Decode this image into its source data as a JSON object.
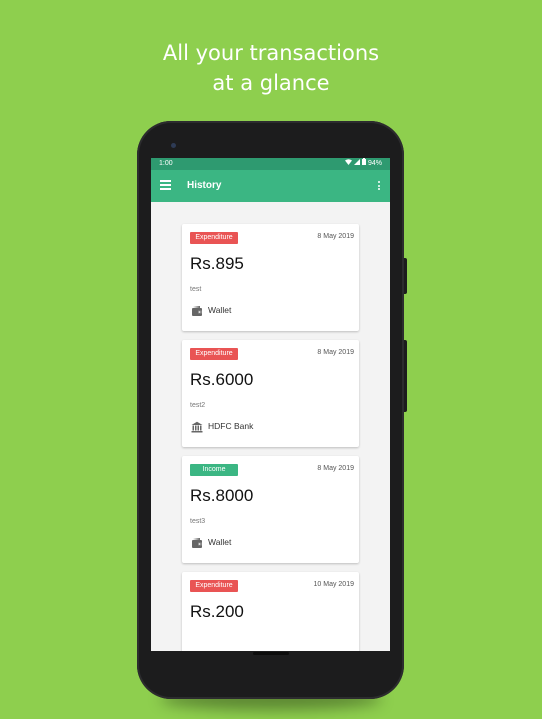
{
  "promo": {
    "line1": "All your transactions",
    "line2": "at a glance"
  },
  "status_bar": {
    "time": "1:00",
    "battery": "94%"
  },
  "app_bar": {
    "title": "History"
  },
  "transactions": [
    {
      "type": "Expenditure",
      "date": "8 May 2019",
      "amount": "Rs.895",
      "note": "test",
      "account": "Wallet",
      "account_icon": "wallet-icon"
    },
    {
      "type": "Expenditure",
      "date": "8 May 2019",
      "amount": "Rs.6000",
      "note": "test2",
      "account": "HDFC Bank",
      "account_icon": "bank-icon"
    },
    {
      "type": "Income",
      "date": "8 May 2019",
      "amount": "Rs.8000",
      "note": "test3",
      "account": "Wallet",
      "account_icon": "wallet-icon"
    },
    {
      "type": "Expenditure",
      "date": "10 May 2019",
      "amount": "Rs.200",
      "note": "",
      "account": "",
      "account_icon": ""
    }
  ],
  "colors": {
    "background": "#8ecf4e",
    "app_bar": "#3bb683",
    "status_bar": "#2e9a70",
    "expenditure": "#e95454",
    "income": "#3bb683"
  }
}
